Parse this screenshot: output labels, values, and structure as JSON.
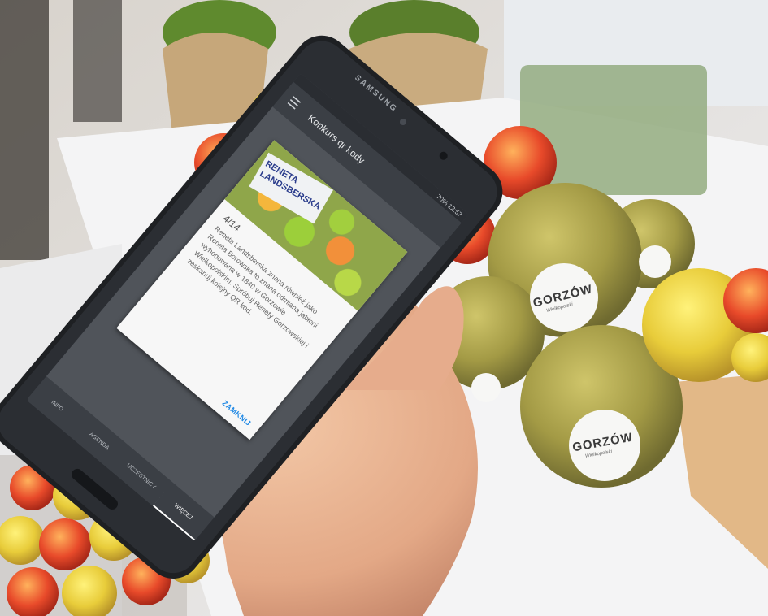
{
  "device": {
    "brand": "SAMSUNG"
  },
  "status_bar": {
    "text": "70% 12:57"
  },
  "app": {
    "menu_icon": "hamburger-menu-icon",
    "title": "Konkurs qr kody"
  },
  "dialog": {
    "image_sign": "RENETA LANDSBERSKA",
    "counter": "4/14",
    "description": "Reneta Landsberska znana również jako Reneta Borowska to znana odmiana jabłoni wyhodowana w 1840 w Gorzowie Wielkopolskim. Spróbuj Renety Gorzowskiej i zeskanuj kolejny QR kod.",
    "button": "ZAMKNIJ"
  },
  "tabs": [
    {
      "label": "INFO"
    },
    {
      "label": "AGENDA"
    },
    {
      "label": "UCZESTNICY"
    },
    {
      "label": "WIĘCEJ"
    }
  ],
  "stickers": {
    "main": "GORZÓW",
    "sub": "Wielkopolski"
  },
  "colors": {
    "accent": "#1e88e5",
    "app_bar": "#3b3f45"
  }
}
